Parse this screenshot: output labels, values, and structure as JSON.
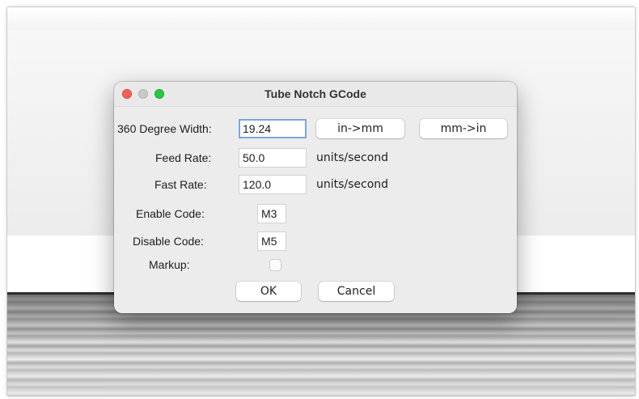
{
  "dialog": {
    "title": "Tube Notch GCode",
    "fields": {
      "width": {
        "label": "360 Degree Width:",
        "value": "19.24"
      },
      "feed": {
        "label": "Feed Rate:",
        "value": "50.0",
        "unit": "units/second"
      },
      "fast": {
        "label": "Fast Rate:",
        "value": "120.0",
        "unit": "units/second"
      },
      "enable": {
        "label": "Enable Code:",
        "value": "M3"
      },
      "disable": {
        "label": "Disable Code:",
        "value": "M5"
      },
      "markup": {
        "label": "Markup:",
        "checked": false
      }
    },
    "buttons": {
      "in_to_mm": "in->mm",
      "mm_to_in": "mm->in",
      "ok": "OK",
      "cancel": "Cancel"
    }
  },
  "colors": {
    "close": "#fe5f57",
    "minimize": "#c9c9c9",
    "zoom": "#28c840",
    "focus_ring": "#7aa6e0"
  }
}
